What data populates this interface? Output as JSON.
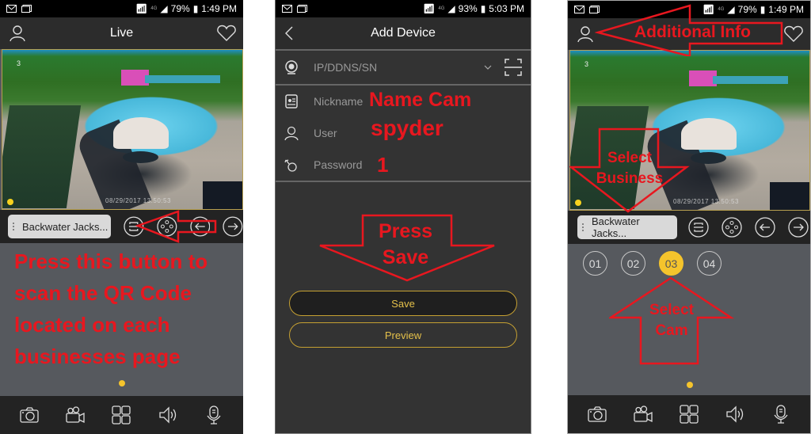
{
  "status_bar_1": {
    "battery": "79%",
    "time": "1:49 PM",
    "network": "4G"
  },
  "status_bar_2": {
    "battery": "93%",
    "time": "5:03 PM",
    "network": "4G"
  },
  "status_bar_3": {
    "battery": "79%",
    "time": "1:49 PM",
    "network": "4G"
  },
  "live_screen": {
    "title": "Live",
    "camera_number": "3",
    "video_timestamp": "08/29/2017 13:50:53",
    "device_chip": "Backwater Jacks...",
    "annotation": "Press this button to scan the QR Code located on each businesses page"
  },
  "add_device_screen": {
    "title": "Add Device",
    "address_placeholder": "IP/DDNS/SN",
    "nickname_label": "Nickname",
    "user_label": "User",
    "password_label": "Password",
    "annotation_nickname": "Name Cam",
    "annotation_user": "spyder",
    "annotation_password": "1",
    "annotation_arrow": "Press Save",
    "annotation_arrow_line1": "Press",
    "annotation_arrow_line2": "Save",
    "save_label": "Save",
    "preview_label": "Preview"
  },
  "live_screen_2": {
    "camera_number": "3",
    "video_timestamp": "08/29/2017 13:50:53",
    "device_chip": "Backwater Jacks...",
    "annotation_info": "Additional Info",
    "annotation_business_line1": "Select",
    "annotation_business_line2": "Business",
    "annotation_cam_line1": "Select",
    "annotation_cam_line2": "Cam",
    "channels": [
      "01",
      "02",
      "03",
      "04"
    ],
    "active_channel": "03"
  },
  "colors": {
    "annotation_red": "#e8171f",
    "accent_yellow": "#f5c42c",
    "button_gold": "#c5a032"
  }
}
